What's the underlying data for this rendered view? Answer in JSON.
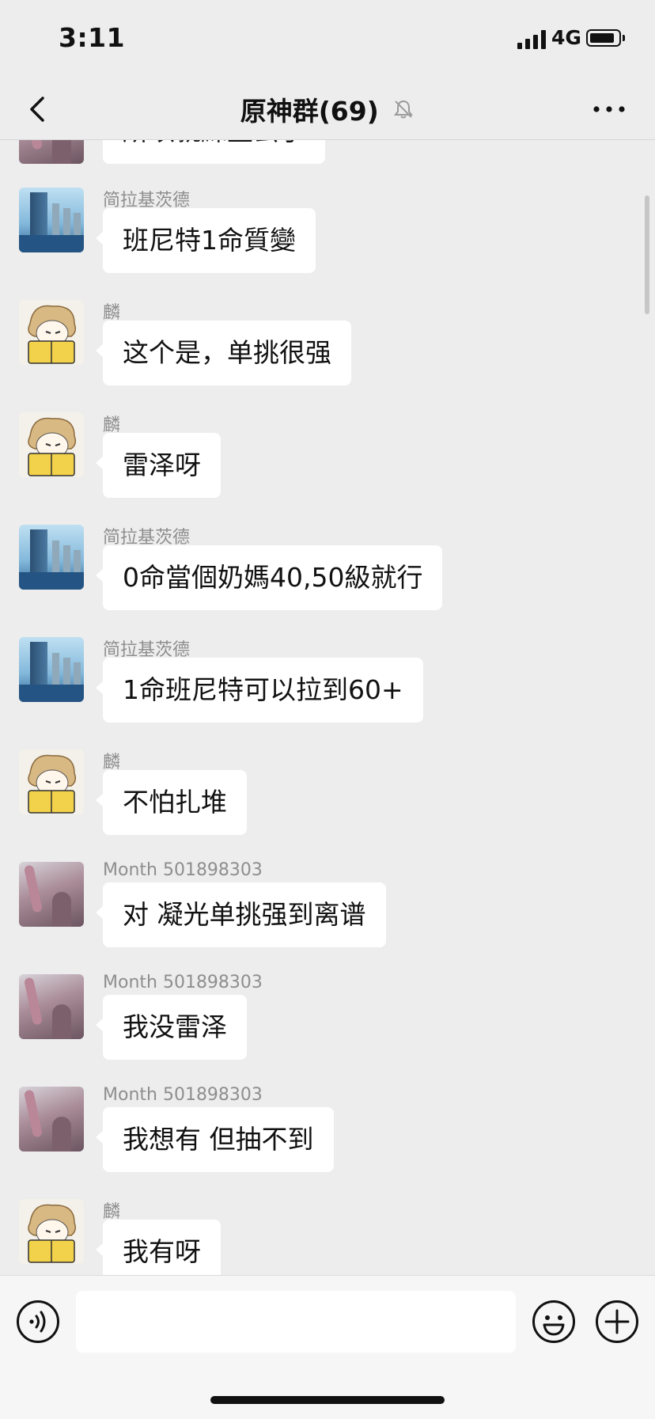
{
  "status_bar": {
    "time": "3:11",
    "network": "4G"
  },
  "header": {
    "title": "原神群(69)"
  },
  "partial_top_message": {
    "text": "所以就練重云了"
  },
  "messages": [
    {
      "sender": "简拉基茨德",
      "avatar": "building",
      "text": "班尼特1命質變"
    },
    {
      "sender": "麟",
      "avatar": "cartoon",
      "text": "这个是，单挑很强"
    },
    {
      "sender": "麟",
      "avatar": "cartoon",
      "text": "雷泽呀"
    },
    {
      "sender": "简拉基茨德",
      "avatar": "building",
      "text": "0命當個奶媽40,50級就行"
    },
    {
      "sender": "简拉基茨德",
      "avatar": "building",
      "text": "1命班尼特可以拉到60+"
    },
    {
      "sender": "麟",
      "avatar": "cartoon",
      "text": "不怕扎堆"
    },
    {
      "sender": "Month 501898303",
      "avatar": "girl",
      "text": "对 凝光单挑强到离谱"
    },
    {
      "sender": "Month 501898303",
      "avatar": "girl",
      "text": "我没雷泽"
    },
    {
      "sender": "Month 501898303",
      "avatar": "girl",
      "text": "我想有 但抽不到"
    },
    {
      "sender": "麟",
      "avatar": "cartoon",
      "text": "我有呀"
    }
  ],
  "input": {
    "value": "",
    "placeholder": ""
  },
  "icons": {
    "back": "chevron-left-icon",
    "mute": "bell-slash-icon",
    "more": "ellipsis-icon",
    "voice": "voice-icon",
    "emoji": "smile-icon",
    "plus": "plus-circle-icon"
  },
  "colors": {
    "background": "#ededed",
    "bubble": "#ffffff",
    "sender": "#8e8e8e"
  }
}
